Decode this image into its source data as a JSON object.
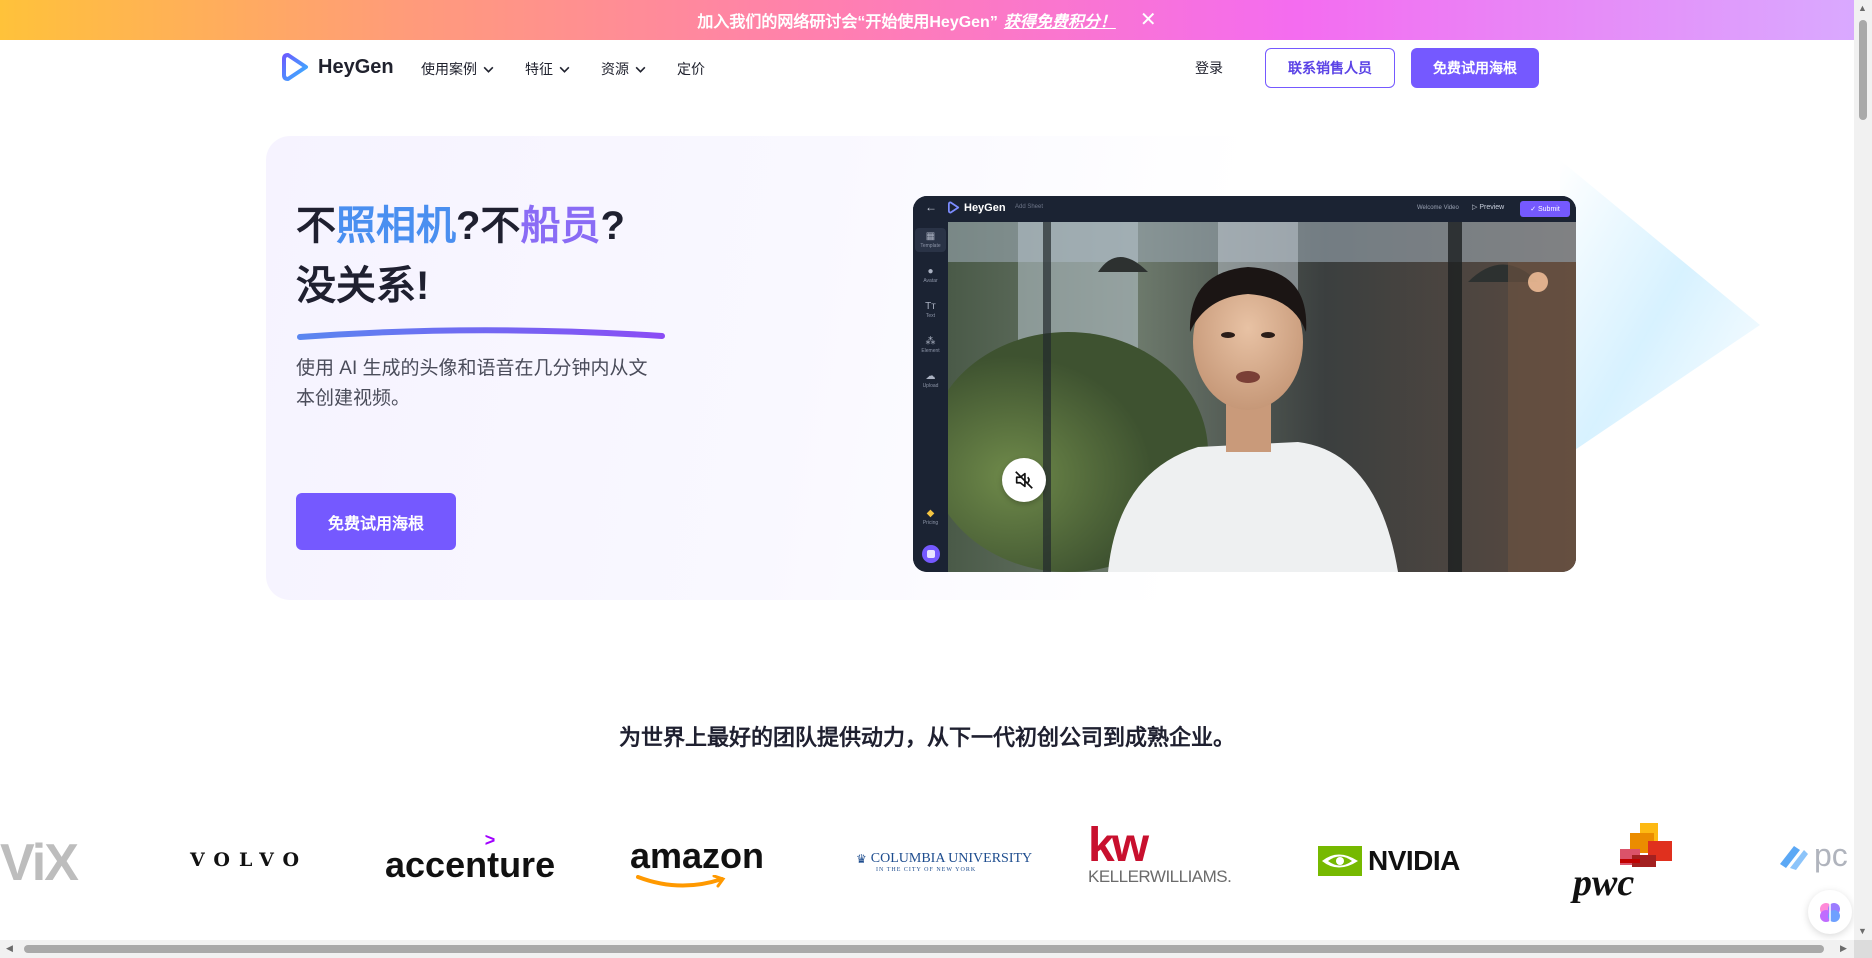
{
  "banner": {
    "text": "加入我们的网络研讨会“开始使用HeyGen”",
    "link": "获得免费积分！",
    "close_icon": "close-icon"
  },
  "nav": {
    "brand": "HeyGen",
    "menu": [
      {
        "label": "使用案例",
        "has_dropdown": true
      },
      {
        "label": "特征",
        "has_dropdown": true
      },
      {
        "label": "资源",
        "has_dropdown": true
      },
      {
        "label": "定价",
        "has_dropdown": false
      }
    ],
    "login": "登录",
    "contact_sales": "联系销售人员",
    "free_trial": "免费试用海根"
  },
  "hero": {
    "title_part1": "不",
    "title_part2": "照相机",
    "title_part3": "?不",
    "title_part4": "船员",
    "title_part5": "?",
    "title_line2": "没关系!",
    "subtitle": "使用 AI 生成的头像和语音在几分钟内从文本创建视频。",
    "cta": "免费试用海根"
  },
  "editor": {
    "brand": "HeyGen",
    "project_placeholder": "Add Sheet",
    "welcome_label": "Welcome Video",
    "preview_label": "Preview",
    "submit_label": "Submit",
    "sidebar": [
      {
        "label": "Template",
        "icon": "template-icon"
      },
      {
        "label": "Avatar",
        "icon": "avatar-icon"
      },
      {
        "label": "Text",
        "icon": "text-icon"
      },
      {
        "label": "Element",
        "icon": "element-icon"
      },
      {
        "label": "Upload",
        "icon": "upload-icon"
      },
      {
        "label": "Pricing",
        "icon": "diamond-icon"
      }
    ]
  },
  "tagline": "为世界上最好的团队提供动力，从下一代初创公司到成熟企业。",
  "logos": {
    "wix": "ViX",
    "volvo": "VOLVO",
    "accenture": "accenture",
    "amazon": "amazon",
    "columbia_line1": "COLUMBIA UNIVERSITY",
    "columbia_line2": "IN THE CITY OF NEW YORK",
    "kw": "kw",
    "keller": "KELLERWILLIAMS.",
    "nvidia": "NVIDIA",
    "pwc": "pwc",
    "partial": "pc"
  },
  "colors": {
    "accent": "#7559ff",
    "hero_blue": "#4a8ff0",
    "hero_purple": "#8a6cf5"
  }
}
